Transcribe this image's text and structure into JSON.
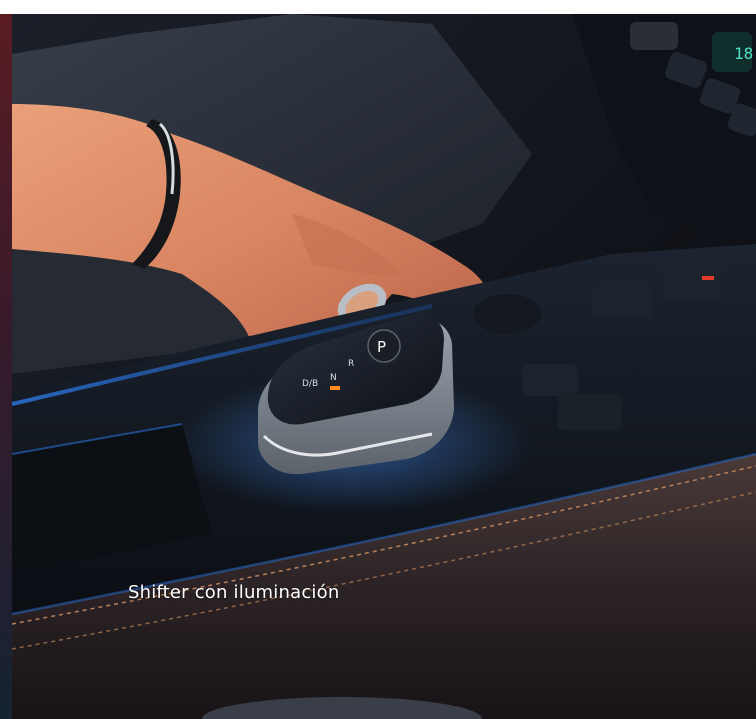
{
  "caption": "Shifter con iluminación",
  "shifter": {
    "gear_top": "P",
    "gear_mid": "R",
    "gear_n": "N",
    "gear_d": "D/B"
  },
  "colors": {
    "accent_orange": "#ff8a1c",
    "ambient_blue": "#2a6fd1",
    "stitching": "#b98158"
  }
}
